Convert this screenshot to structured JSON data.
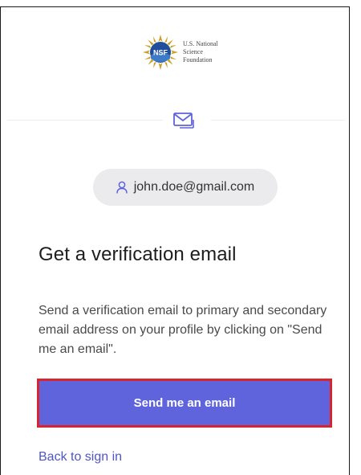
{
  "logo": {
    "seal_text": "NSF",
    "lines": [
      "U.S. National",
      "Science",
      "Foundation"
    ]
  },
  "account": {
    "email": "john.doe@gmail.com"
  },
  "main": {
    "title": "Get a verification email",
    "description": "Send a verification email to primary and secondary email address on your profile by clicking on \"Send me an email\".",
    "send_button_label": "Send me an email",
    "back_link_label": "Back to sign in"
  },
  "icons": {
    "mail": "mail-icon",
    "user": "user-icon"
  },
  "colors": {
    "primary_button": "#5f63dc",
    "highlight_border": "#d8242c",
    "link": "#4d55c7",
    "pill_bg": "#ebebed"
  }
}
